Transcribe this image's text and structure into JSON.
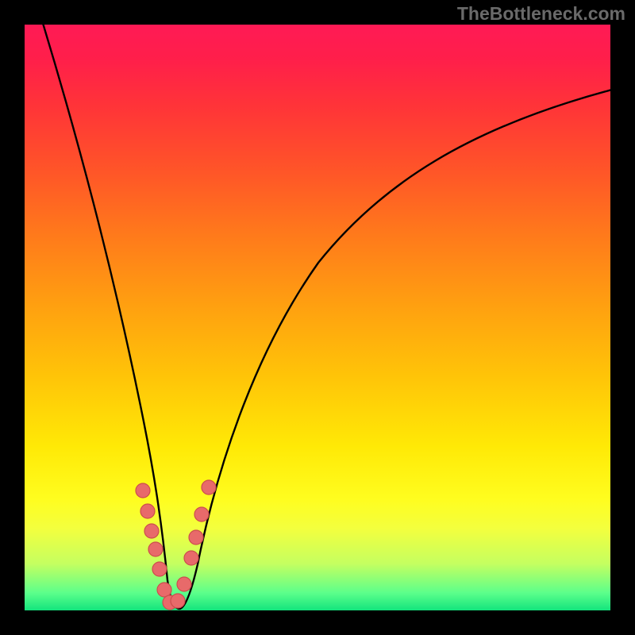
{
  "watermark": "TheBottleneck.com",
  "colors": {
    "frame": "#000000",
    "curve": "#000000",
    "markers_fill": "#e86a6a",
    "markers_stroke": "#cc4d4d"
  },
  "chart_data": {
    "type": "line",
    "title": "",
    "xlabel": "",
    "ylabel": "",
    "xlim": [
      0,
      100
    ],
    "ylim": [
      0,
      100
    ],
    "notch_x": 25,
    "series": [
      {
        "name": "left-branch",
        "x": [
          3,
          6,
          9,
          12,
          15,
          18,
          20,
          22,
          23.5,
          25
        ],
        "y": [
          100,
          85,
          70,
          55,
          40,
          27,
          18,
          10,
          4,
          0
        ]
      },
      {
        "name": "right-branch",
        "x": [
          25,
          27,
          30,
          34,
          40,
          48,
          58,
          70,
          84,
          100
        ],
        "y": [
          0,
          5,
          16,
          30,
          45,
          58,
          69,
          78,
          85,
          89
        ]
      }
    ],
    "markers": [
      {
        "x": 20.2,
        "y": 20.5,
        "r": 2.6
      },
      {
        "x": 21.0,
        "y": 17.0,
        "r": 2.6
      },
      {
        "x": 21.7,
        "y": 13.5,
        "r": 2.6
      },
      {
        "x": 22.3,
        "y": 10.4,
        "r": 2.6
      },
      {
        "x": 23.0,
        "y": 7.0,
        "r": 2.6
      },
      {
        "x": 23.8,
        "y": 3.5,
        "r": 2.6
      },
      {
        "x": 24.8,
        "y": 1.3,
        "r": 2.6
      },
      {
        "x": 26.2,
        "y": 1.6,
        "r": 2.6
      },
      {
        "x": 27.2,
        "y": 4.5,
        "r": 2.6
      },
      {
        "x": 28.4,
        "y": 9.0,
        "r": 2.6
      },
      {
        "x": 29.2,
        "y": 12.5,
        "r": 2.6
      },
      {
        "x": 30.2,
        "y": 16.5,
        "r": 2.6
      },
      {
        "x": 31.4,
        "y": 21.0,
        "r": 2.6
      }
    ],
    "gradient_stops": [
      {
        "pos": 0,
        "color": "#ff1a55"
      },
      {
        "pos": 25,
        "color": "#ff5528"
      },
      {
        "pos": 60,
        "color": "#ffc408"
      },
      {
        "pos": 81,
        "color": "#fffd1f"
      },
      {
        "pos": 100,
        "color": "#13e47d"
      }
    ]
  }
}
